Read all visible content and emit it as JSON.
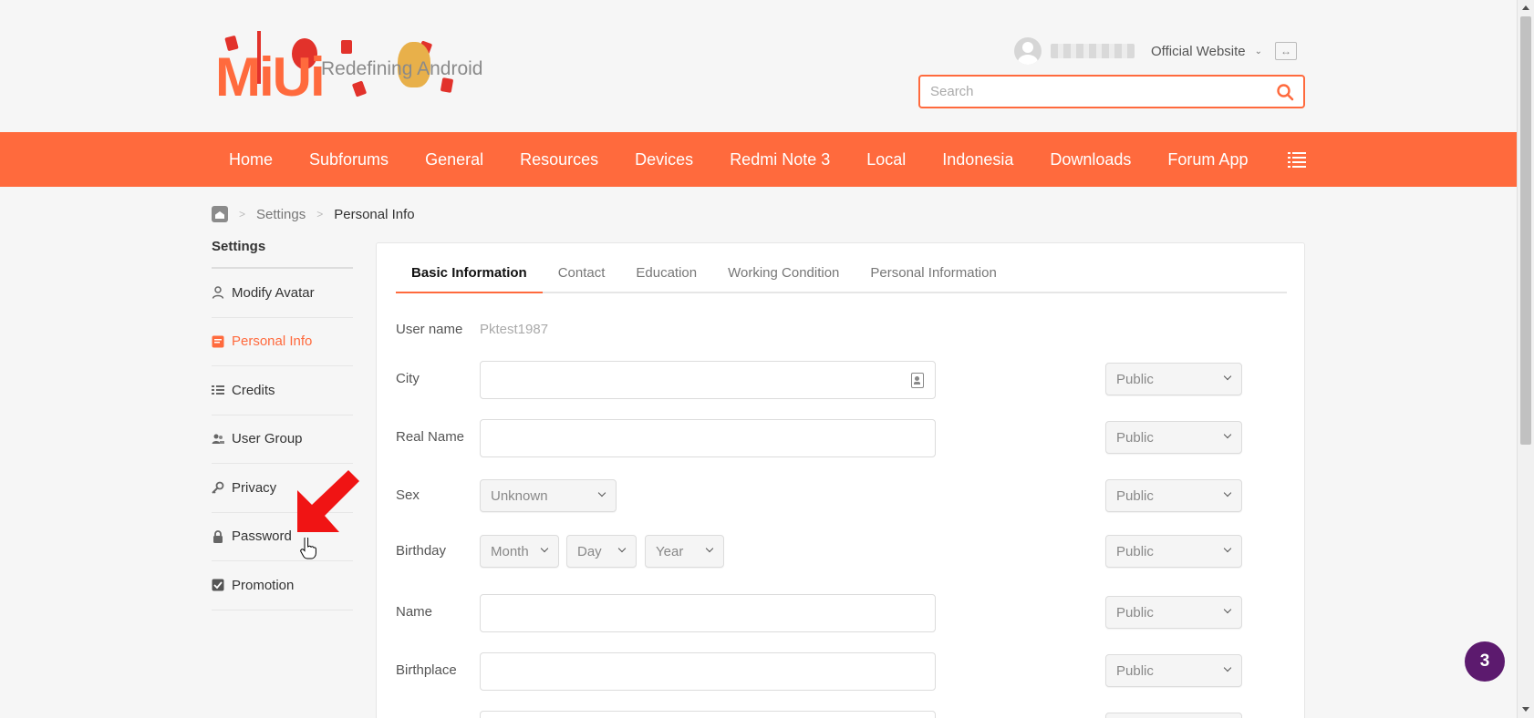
{
  "header": {
    "logo_text": "MiUi",
    "logo_subtitle": "Redefining Android",
    "official_website": "Official Website",
    "search_placeholder": "Search"
  },
  "nav": {
    "items": [
      "Home",
      "Subforums",
      "General",
      "Resources",
      "Devices",
      "Redmi Note 3",
      "Local",
      "Indonesia",
      "Downloads",
      "Forum App"
    ]
  },
  "breadcrumb": {
    "items": [
      "Settings",
      "Personal Info"
    ]
  },
  "sidebar": {
    "title": "Settings",
    "items": [
      {
        "label": "Modify Avatar",
        "icon": "user-icon"
      },
      {
        "label": "Personal Info",
        "icon": "document-icon"
      },
      {
        "label": "Credits",
        "icon": "list-icon"
      },
      {
        "label": "User Group",
        "icon": "users-icon"
      },
      {
        "label": "Privacy",
        "icon": "key-icon"
      },
      {
        "label": "Password",
        "icon": "lock-icon"
      },
      {
        "label": "Promotion",
        "icon": "checkbox-icon"
      }
    ],
    "active_index": 1
  },
  "tabs": [
    "Basic Information",
    "Contact",
    "Education",
    "Working Condition",
    "Personal Information"
  ],
  "form": {
    "username_label": "User name",
    "username_value": "Pktest1987",
    "city_label": "City",
    "city_value": "",
    "realname_label": "Real Name",
    "realname_value": "",
    "sex_label": "Sex",
    "sex_value": "Unknown",
    "birthday_label": "Birthday",
    "birthday_month": "Month",
    "birthday_day": "Day",
    "birthday_year": "Year",
    "name_label": "Name",
    "name_value": "",
    "birthplace_label": "Birthplace",
    "birthplace_value": "",
    "privacy_value": "Public"
  },
  "badge": {
    "count": "3"
  },
  "colors": {
    "accent": "#ff6a3d",
    "badge": "#5c1a6e"
  }
}
